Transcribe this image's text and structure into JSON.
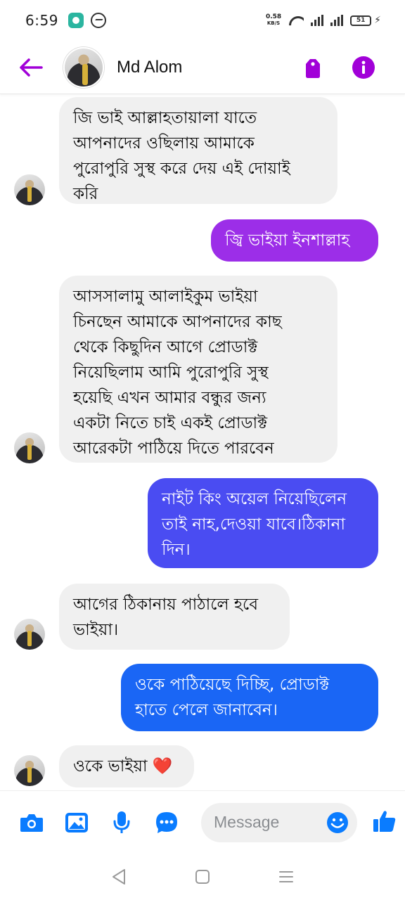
{
  "status_bar": {
    "time": "6:59",
    "net_speed_value": "0.58",
    "net_speed_unit": "KB/S",
    "battery": "51"
  },
  "header": {
    "contact_name": "Md Alom",
    "accent_color": "#a100d8"
  },
  "messages": [
    {
      "direction": "incoming",
      "text": "জি ভাই আল্লাহতায়ালা যাতে\nআপনাদের ওছিলায় আমাকে\nপুরোপুরি সুস্থ করে দেয় এই দোয়াই\nকরি"
    },
    {
      "direction": "outgoing",
      "text": "জ্বি ভাইয়া ইনশাল্লাহ",
      "color": "#9c2ee8"
    },
    {
      "direction": "incoming",
      "text": "আসসালামু আলাইকুম ভাইয়া\nচিনছেন আমাকে আপনাদের কাছ\nথেকে কিছুদিন আগে প্রোডাক্ট\nনিয়েছিলাম আমি পুরোপুরি সুস্থ\nহয়েছি এখন আমার বন্ধুর জন্য\nএকটা নিতে চাই একই প্রোডাক্ট\nআরেকটা পাঠিয়ে দিতে পারবেন"
    },
    {
      "direction": "outgoing",
      "text": "নাইট কিং অয়েল নিয়েছিলেন\nতাই নাহ,দেওয়া যাবে।ঠিকানা\nদিন।",
      "color": "#4a4cf2"
    },
    {
      "direction": "incoming",
      "text": "আগের ঠিকানায় পাঠালে হবে\nভাইয়া।"
    },
    {
      "direction": "outgoing",
      "text": "ওকে পাঠিয়েছে দিচ্ছি, প্রোডাক্ট\nহাতে পেলে জানাবেন।",
      "color": "#1a66f5"
    },
    {
      "direction": "incoming",
      "text": "ওকে ভাইয়া ❤️"
    }
  ],
  "composer": {
    "placeholder": "Message",
    "icon_color": "#0a7cff"
  }
}
